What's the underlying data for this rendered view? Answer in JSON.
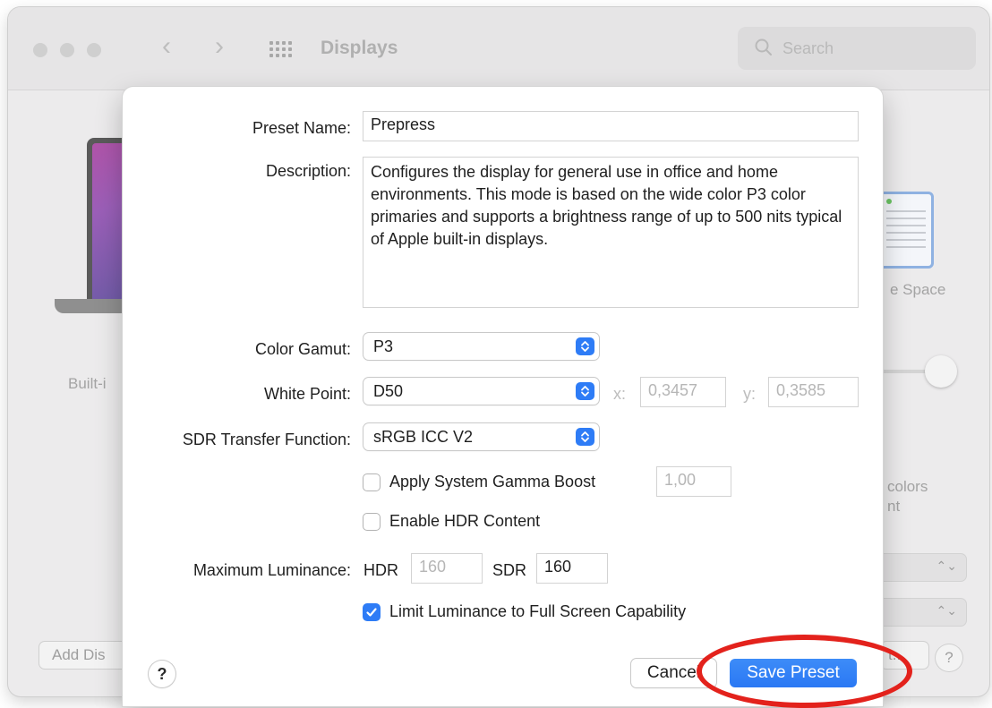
{
  "window": {
    "title": "Displays",
    "search_placeholder": "Search",
    "background": {
      "built_in_label": "Built-i",
      "space_label": "e Space",
      "colors_label": "colors",
      "nt_label": "nt",
      "add_display_label": "Add Dis",
      "t_button_label": "t...",
      "help_label": "?"
    }
  },
  "sheet": {
    "preset_name_label": "Preset Name:",
    "preset_name_value": "Prepress",
    "description_label": "Description:",
    "description_value": "Configures the display for general use in office and home environments. This mode is based on the wide color P3 color primaries and supports a brightness range of up to 500 nits typical of Apple built-in displays.",
    "color_gamut_label": "Color Gamut:",
    "color_gamut_value": "P3",
    "white_point_label": "White Point:",
    "white_point_value": "D50",
    "white_point_x_label": "x:",
    "white_point_x_value": "0,3457",
    "white_point_y_label": "y:",
    "white_point_y_value": "0,3585",
    "sdr_transfer_label": "SDR Transfer Function:",
    "sdr_transfer_value": "sRGB ICC V2",
    "gamma_boost_label": "Apply System Gamma Boost",
    "gamma_boost_value": "1,00",
    "gamma_boost_checked": false,
    "hdr_content_label": "Enable HDR Content",
    "hdr_content_checked": false,
    "max_luminance_label": "Maximum Luminance:",
    "hdr_label": "HDR",
    "hdr_value": "160",
    "sdr_label": "SDR",
    "sdr_value": "160",
    "limit_luminance_label": "Limit Luminance to Full Screen Capability",
    "limit_luminance_checked": true,
    "help_label": "?",
    "cancel_label": "Cancel",
    "save_label": "Save Preset"
  },
  "colors": {
    "accent": "#2e7cf6",
    "annotation": "#e3221c"
  }
}
